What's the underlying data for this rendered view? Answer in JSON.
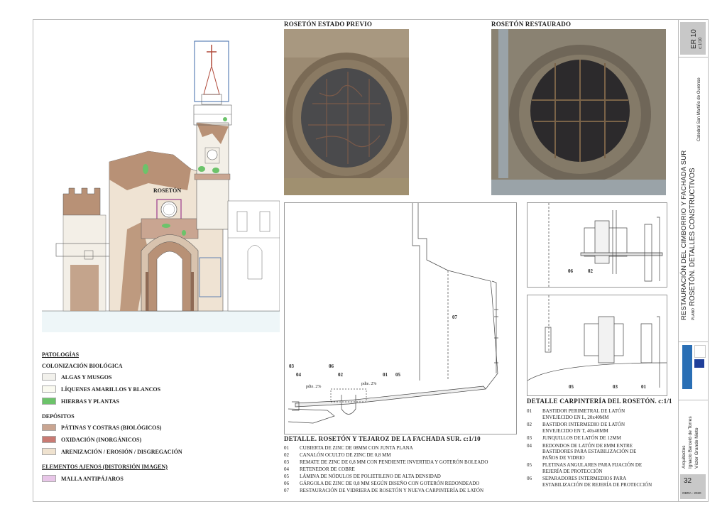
{
  "photos": {
    "before_title": "ROSETÓN ESTADO PREVIO",
    "after_title": "ROSETÓN RESTAURADO"
  },
  "elevation": {
    "roseton_label": "ROSETÓN"
  },
  "legend": {
    "title": "PATOLOGÍAS",
    "groups": [
      {
        "heading": "COLONIZACIÓN BIOLÓGICA",
        "items": [
          {
            "label": "ALGAS Y MUSGOS",
            "color": "#f2f1ec"
          },
          {
            "label": "LÍQUENES AMARILLOS Y BLANCOS",
            "color": "#fafaf0"
          },
          {
            "label": "HIERBAS Y PLANTAS",
            "color": "#6cc36a"
          }
        ]
      },
      {
        "heading": "DEPÓSITOS",
        "items": [
          {
            "label": "PÁTINAS Y COSTRAS (BIOLÓGICOS)",
            "color": "#c9a591"
          },
          {
            "label": "OXIDACIÓN (INORGÁNICOS)",
            "color": "#c97a73"
          },
          {
            "label": "ARENIZACIÓN / EROSIÓN / DISGREGACIÓN",
            "color": "#efe2cf"
          }
        ]
      }
    ],
    "foreign_title": "ELEMENTOS AJENOS (DISTORSIÓN IMAGEN)",
    "foreign_items": [
      {
        "label": "MALLA ANTIPÁJAROS",
        "color": "#e8c6e8"
      }
    ]
  },
  "detail_main": {
    "title": "DETALLE. ROSETÓN Y TEJAROZ DE LA FACHADA SUR.",
    "scale": "c:1/10",
    "labels": {
      "n03": "03",
      "n04": "04",
      "n06": "06",
      "n02": "02",
      "n01": "01",
      "n05": "05",
      "n07": "07"
    },
    "slope1": "pdte. 2%",
    "slope2": "pdte. 2%",
    "notes": [
      {
        "n": "01",
        "text": "CUBIERTA DE ZINC DE 08MM CON JUNTA PLANA"
      },
      {
        "n": "02",
        "text": "CANALÓN OCULTO DE ZINC DE 0,8 MM"
      },
      {
        "n": "03",
        "text": "REMATE DE ZINC DE 0,8 MM CON PENDIENTE INVERTIDA Y GOTERÓN BOLEADO"
      },
      {
        "n": "04",
        "text": "RETENEDOR DE COBRE"
      },
      {
        "n": "05",
        "text": "LÁMINA DE NÓDULOS DE POLIETILENO DE ALTA DENSIDAD"
      },
      {
        "n": "06",
        "text": "GÁRGOLA DE ZINC DE 0,8 MM SEGÚN DISEÑO CON GOTERÓN REDONDEADO"
      },
      {
        "n": "07",
        "text": "RESTAURACIÓN DE VIDRIERA DE ROSETÓN Y NUEVA CARPINTERÍA DE LATÓN"
      }
    ]
  },
  "detail_carp": {
    "title": "DETALLE CARPINTERÍA DEL ROSETÓN.",
    "scale": "c:1/1",
    "top_labels": {
      "a": "06",
      "b": "02"
    },
    "bottom_labels": {
      "a": "05",
      "b": "03",
      "c": "01"
    },
    "notes": [
      {
        "n": "01",
        "lines": [
          "BASTIDOR PERIMETRAL DE LATÓN",
          "ENVEJECIDO EN L, 20x40MM"
        ]
      },
      {
        "n": "02",
        "lines": [
          "BASTIDOR INTERMEDIO DE LATÓN",
          "ENVEJECIDO EN T, 40x40MM"
        ]
      },
      {
        "n": "03",
        "lines": [
          "JUNQUILLOS DE LATÓN DE 12MM"
        ]
      },
      {
        "n": "04",
        "lines": [
          "REDONDOS DE LATÓN DE 8MM ENTRE",
          "BASTIDORES PARA ESTABILIZACIÓN DE",
          "PAÑOS DE VIDRIO"
        ]
      },
      {
        "n": "05",
        "lines": [
          "PLETINAS ANGULARES PARA FIJACIÓN DE",
          "REJERÍA DE PROTECCIÓN"
        ]
      },
      {
        "n": "06",
        "lines": [
          "SEPARADORES INTERMEDIOS PARA",
          "ESTABILIZACIÓN DE REJERÍA DE PROTECCIÓN"
        ]
      }
    ]
  },
  "title_block": {
    "sheet_code": "ER 10",
    "sheet_scale": "c:1/10",
    "location": "Catedral San Martiño de Ourense",
    "project_title": "RESTAURACIÓN DEL CIMBORRIO Y FACHADA SUR",
    "plan_prefix": "PLANO",
    "plan_title": "ROSETÓN. DETALLES CONSTRUCTIVOS",
    "architects_label": "Arquitectos",
    "architect1": "Ignacio Barceló de Torres",
    "architect2": "Víctor Grande Nieto",
    "page_number": "32",
    "footer": "OBRA - 2020",
    "brand_colors": {
      "xunta": "#2a6fb5",
      "eu": "#1f3f9a"
    }
  }
}
